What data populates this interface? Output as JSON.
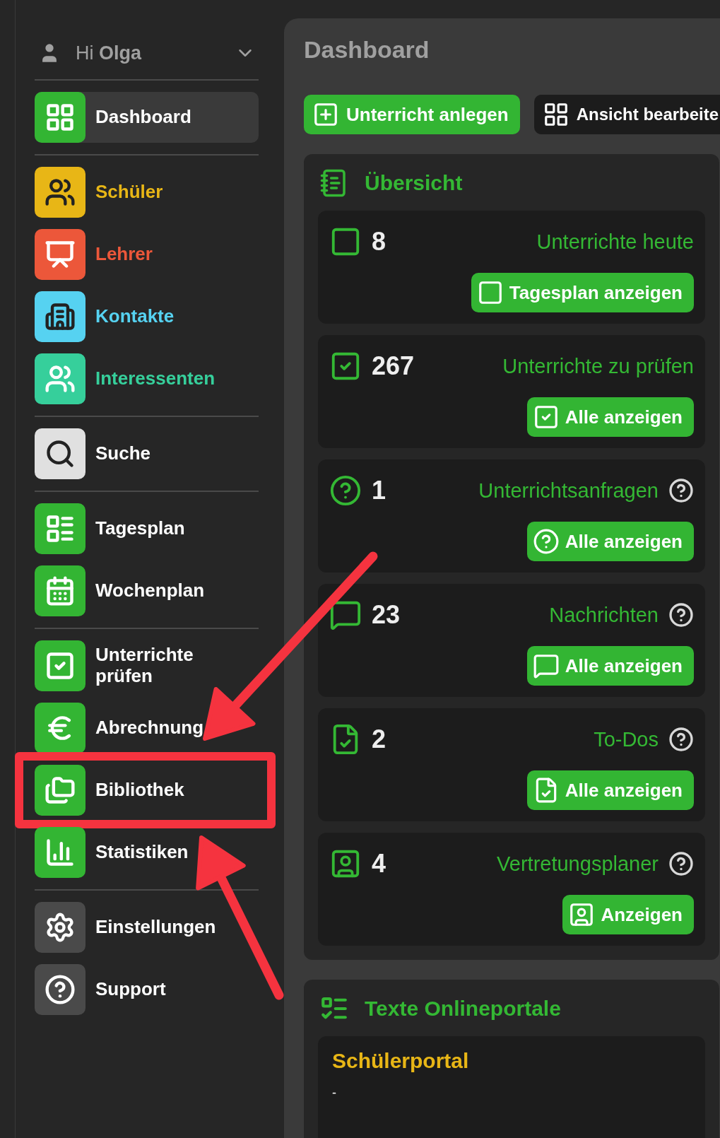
{
  "sidebar": {
    "user": {
      "greeting": "Hi **Olga**",
      "expanded": false
    },
    "groups": [
      [
        {
          "label": "Dashboard",
          "color": "#33b533",
          "tinted": false,
          "selected": true
        }
      ],
      [
        {
          "label": "Schüler",
          "color": "#e8b616",
          "tinted": true,
          "selected": false
        },
        {
          "label": "Lehrer",
          "color": "#ec573a",
          "tinted": true,
          "selected": false
        },
        {
          "label": "Kontakte",
          "color": "#56d2f1",
          "tinted": true,
          "selected": false
        },
        {
          "label": "Interessenten",
          "color": "#36cf9b",
          "tinted": true,
          "selected": false
        }
      ],
      [
        {
          "label": "Suche",
          "color": "#e0e0e0",
          "tinted": false,
          "selected": false
        }
      ],
      [
        {
          "label": "Tagesplan",
          "color": "#33b533",
          "tinted": false,
          "selected": false
        },
        {
          "label": "Wochenplan",
          "color": "#33b533",
          "tinted": false,
          "selected": false
        }
      ],
      [
        {
          "label": "Unterrichte prüfen",
          "color": "#33b533",
          "tinted": false,
          "selected": false
        },
        {
          "label": "Abrechnung",
          "color": "#33b533",
          "tinted": false,
          "selected": false
        },
        {
          "label": "Bibliothek",
          "color": "#33b533",
          "tinted": false,
          "selected": false,
          "highlighted": true
        },
        {
          "label": "Statistiken",
          "color": "#33b533",
          "tinted": false,
          "selected": false
        }
      ],
      [
        {
          "label": "Einstellungen",
          "color": "#4a4a4a",
          "tinted": false,
          "selected": false
        },
        {
          "label": "Support",
          "color": "#4a4a4a",
          "tinted": false,
          "selected": false
        }
      ]
    ]
  },
  "main": {
    "title": "Dashboard",
    "actions": [
      {
        "label": "Unterricht anlegen",
        "kind": "primary"
      },
      {
        "label": "Ansicht bearbeite",
        "kind": "dark"
      }
    ],
    "overview": {
      "title": "Übersicht",
      "cards": [
        {
          "count": "8",
          "label": "Unterrichte heute",
          "help": false,
          "button": "Tagesplan anzeigen"
        },
        {
          "count": "267",
          "label": "Unterrichte zu prüfen",
          "help": false,
          "button": "Alle anzeigen"
        },
        {
          "count": "1",
          "label": "Unterrichtsanfragen",
          "help": true,
          "button": "Alle anzeigen"
        },
        {
          "count": "23",
          "label": "Nachrichten",
          "help": true,
          "button": "Alle anzeigen"
        },
        {
          "count": "2",
          "label": "To-Dos",
          "help": true,
          "button": "Alle anzeigen"
        },
        {
          "count": "4",
          "label": "Vertretungsplaner",
          "help": true,
          "button": "Anzeigen"
        }
      ]
    },
    "portals": {
      "title": "Texte Onlineportale",
      "items": [
        {
          "title": "Schülerportal",
          "text": "-"
        }
      ]
    }
  }
}
